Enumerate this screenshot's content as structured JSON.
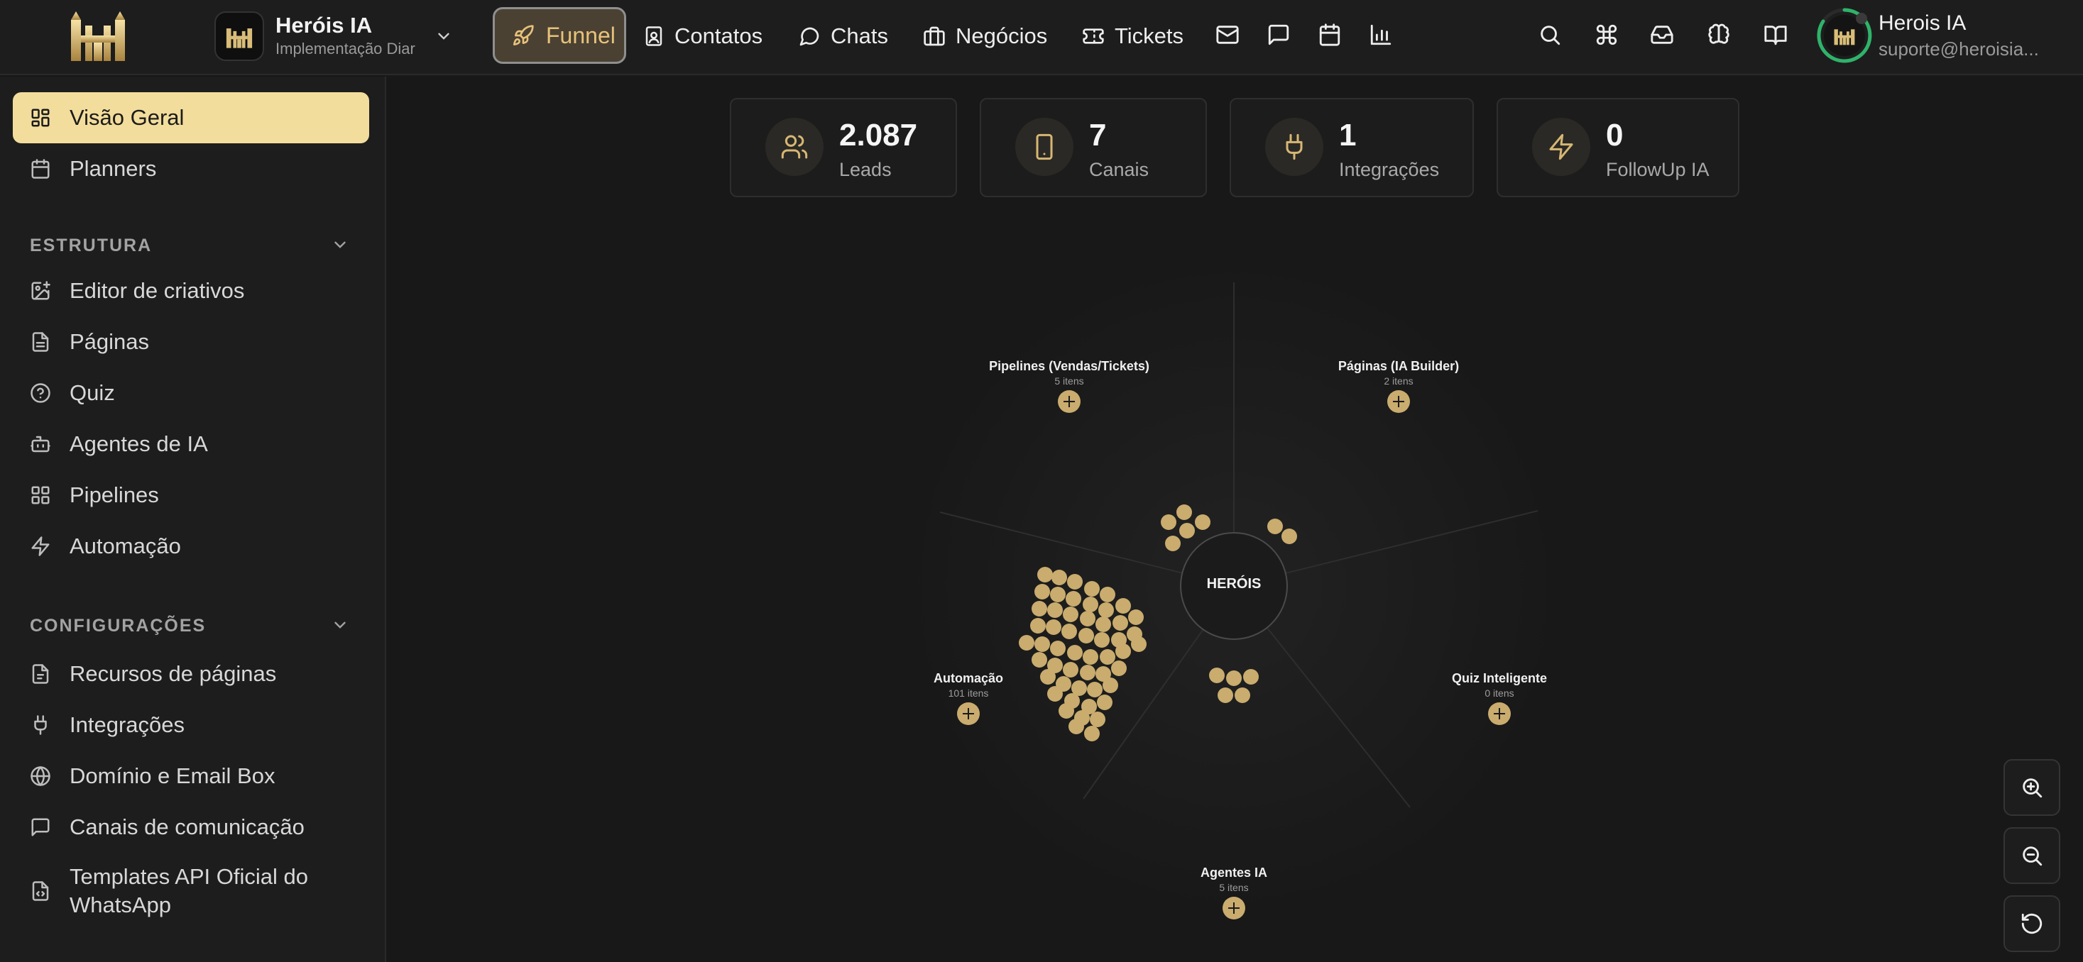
{
  "workspace": {
    "title": "Heróis IA",
    "subtitle": "Implementação Diar"
  },
  "nav": {
    "funnel": "Funnel",
    "contacts": "Contatos",
    "chats": "Chats",
    "deals": "Negócios",
    "tickets": "Tickets"
  },
  "user": {
    "name": "Herois IA",
    "email": "suporte@heroisia..."
  },
  "sidebar": {
    "top": [
      {
        "label": "Visão Geral",
        "active": true,
        "icon": "grid-icon"
      },
      {
        "label": "Planners",
        "active": false,
        "icon": "calendar-icon"
      }
    ],
    "section_structure": "ESTRUTURA",
    "structure": [
      {
        "label": "Editor de criativos",
        "icon": "image-plus-icon"
      },
      {
        "label": "Páginas",
        "icon": "file-icon"
      },
      {
        "label": "Quiz",
        "icon": "help-circle-icon"
      },
      {
        "label": "Agentes de IA",
        "icon": "bot-icon"
      },
      {
        "label": "Pipelines",
        "icon": "grid-icon"
      },
      {
        "label": "Automação",
        "icon": "zap-icon"
      }
    ],
    "section_config": "CONFIGURAÇÕES",
    "config": [
      {
        "label": "Recursos de páginas",
        "icon": "file-settings-icon"
      },
      {
        "label": "Integrações",
        "icon": "plug-icon"
      },
      {
        "label": "Domínio e Email Box",
        "icon": "globe-icon"
      },
      {
        "label": "Canais de comunicação",
        "icon": "message-square-icon"
      },
      {
        "label": "Templates API Oficial do WhatsApp",
        "icon": "file-code-icon"
      }
    ]
  },
  "stats": [
    {
      "value": "2.087",
      "label": "Leads",
      "icon": "users-icon"
    },
    {
      "value": "7",
      "label": "Canais",
      "icon": "smartphone-icon"
    },
    {
      "value": "1",
      "label": "Integrações",
      "icon": "plug-icon"
    },
    {
      "value": "0",
      "label": "FollowUp IA",
      "icon": "zap-icon"
    }
  ],
  "graph": {
    "center": "HERÓIS",
    "nodes": [
      {
        "title": "Pipelines (Vendas/Tickets)",
        "count": "5 itens"
      },
      {
        "title": "Páginas (IA Builder)",
        "count": "2 itens"
      },
      {
        "title": "Automação",
        "count": "101 itens"
      },
      {
        "title": "Quiz Inteligente",
        "count": "0 itens"
      },
      {
        "title": "Agentes IA",
        "count": "5 itens"
      }
    ]
  },
  "colors": {
    "accent": "#f3dd9c",
    "gold": "#c9ac6e",
    "background": "#181818",
    "panel": "#1d1d1d"
  }
}
